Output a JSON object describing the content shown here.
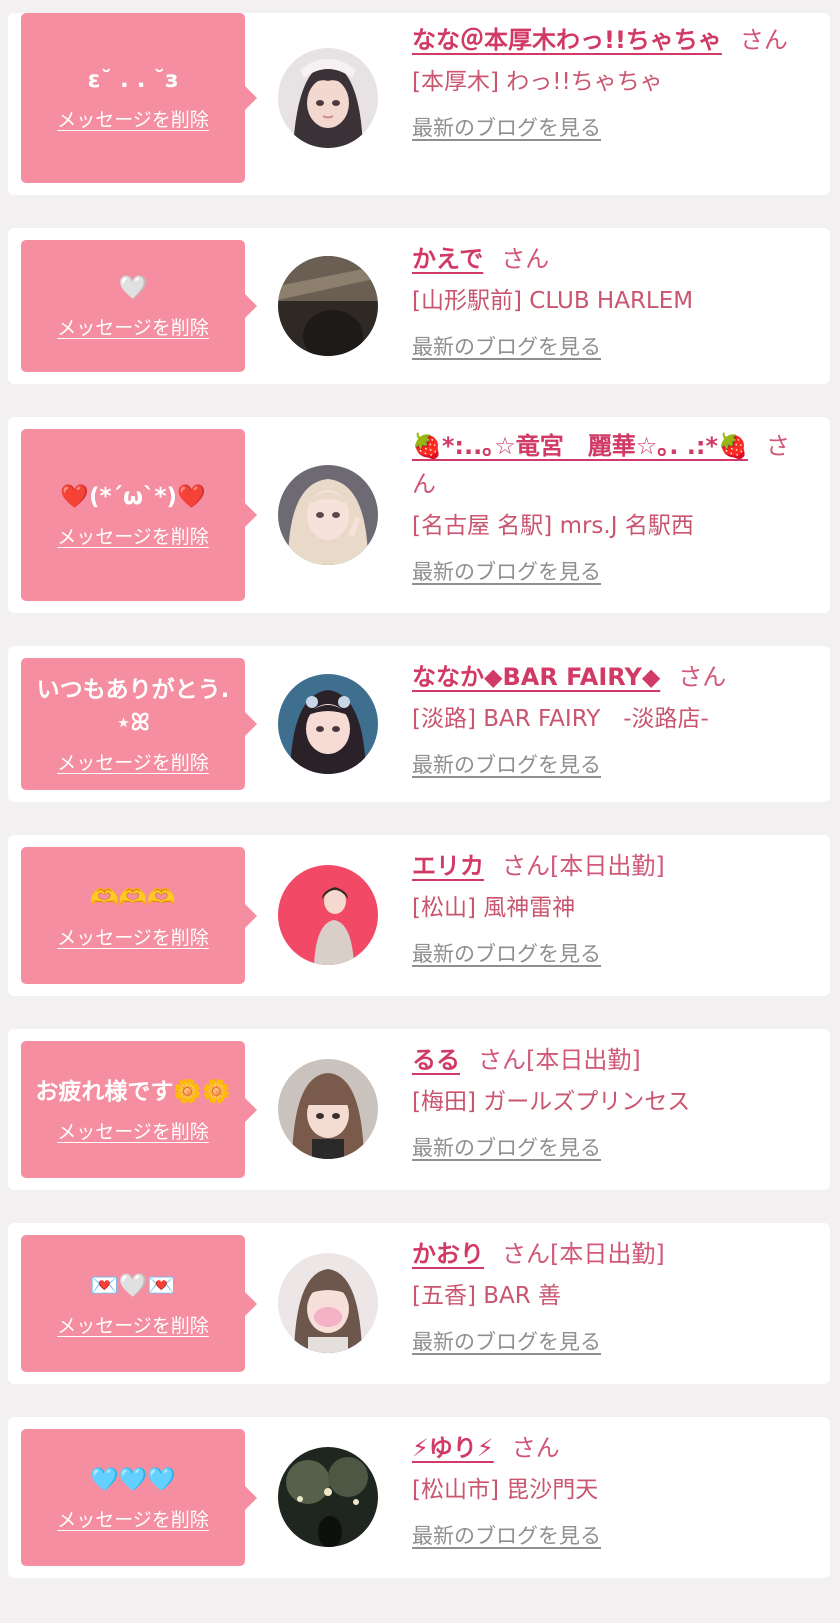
{
  "labels": {
    "delete_message": "メッセージを削除",
    "view_blog": "最新のブログを見る",
    "honorific": "さん",
    "working_today": "[本日出勤]"
  },
  "colors": {
    "bubble": "#f58ea0",
    "name": "#d13a66",
    "link_gray": "#8f8f8f"
  },
  "messages": [
    {
      "message": "ε˘ . . ˘з",
      "name": "なな＠本厚木わっ!!ちゃちゃ",
      "working_today": false,
      "shop": "[本厚木] わっ!!ちゃちゃ"
    },
    {
      "message": "🤍",
      "name": "かえで",
      "working_today": false,
      "shop": "[山形駅前] CLUB HARLEM"
    },
    {
      "message": "❤️(*´ω`*)❤️",
      "name": "🍓*:..｡☆竜宮　麗華☆｡. .:*🍓",
      "working_today": false,
      "shop": "[名古屋 名駅] mrs.J 名駅西"
    },
    {
      "message": "いつもありがとう.⋆ꕤ",
      "name": "ななか◆BAR FAIRY◆",
      "working_today": false,
      "shop": "[淡路] BAR FAIRY　-淡路店-"
    },
    {
      "message": "🫶🫶🫶",
      "name": "エリカ",
      "working_today": true,
      "shop": "[松山] 風神雷神"
    },
    {
      "message": "お疲れ様です🌼🌼",
      "name": "るる",
      "working_today": true,
      "shop": "[梅田] ガールズプリンセス"
    },
    {
      "message": "💌🤍💌",
      "name": "かおり",
      "working_today": true,
      "shop": "[五香] BAR 善"
    },
    {
      "message": "🩵🩵🩵",
      "name": "⚡ゆり⚡",
      "working_today": false,
      "shop": "[松山市] 毘沙門天"
    }
  ]
}
